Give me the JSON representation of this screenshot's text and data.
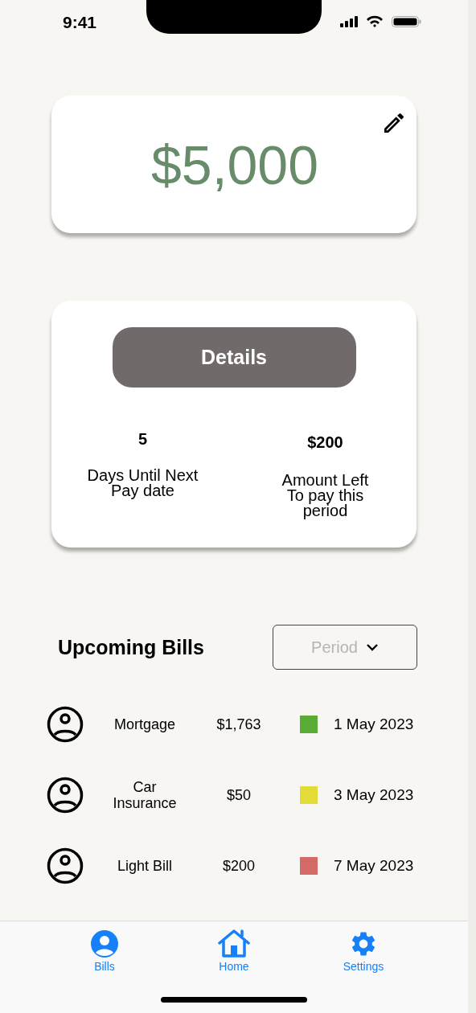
{
  "status_bar": {
    "time": "9:41"
  },
  "balance": {
    "amount": "$5,000"
  },
  "summary": {
    "button": "Details",
    "stats": [
      {
        "value": "5",
        "label": "Days Until Next Pay date"
      },
      {
        "value": "$200",
        "label": "Amount Left To pay this period"
      }
    ]
  },
  "bills": {
    "title": "Upcoming Bills",
    "filter": {
      "placeholder": "Period"
    },
    "rows": [
      {
        "name": "Mortgage",
        "amount": "$1,763",
        "color": "#5aab33",
        "date": "1 May 2023"
      },
      {
        "name": "Car Insurance",
        "amount": "$50",
        "color": "#e3db37",
        "date": "3 May 2023"
      },
      {
        "name": "Light Bill",
        "amount": "$200",
        "color": "#d46a68",
        "date": "7 May 2023"
      }
    ]
  },
  "tab_bar": [
    {
      "kind": "person",
      "label": "Bills"
    },
    {
      "kind": "home",
      "label": "Home"
    },
    {
      "kind": "gear",
      "label": "Settings"
    }
  ]
}
